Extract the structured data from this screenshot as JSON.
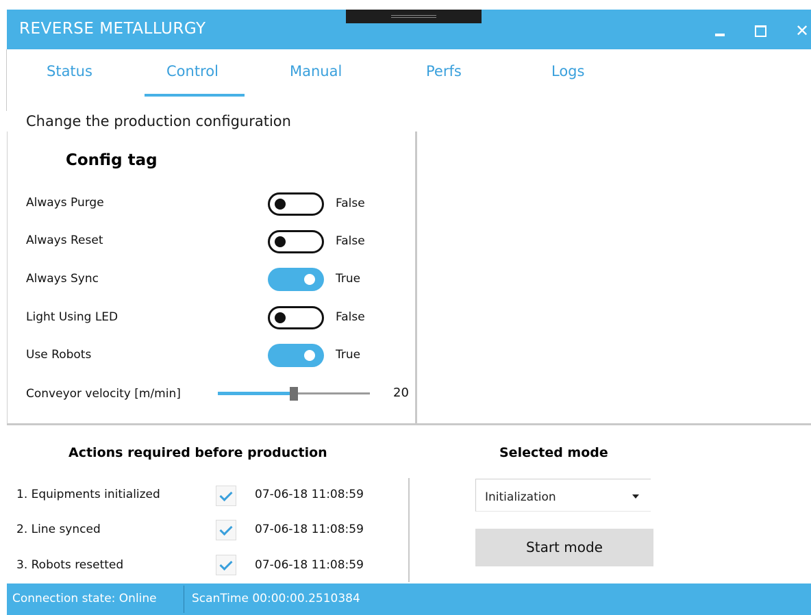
{
  "window": {
    "title": "REVERSE METALLURGY",
    "minimize_icon": "minimize-icon",
    "maximize_icon": "maximize-icon",
    "close_icon": "close-icon",
    "close_glyph": "✕"
  },
  "tabs": [
    {
      "label": "Status",
      "selected": false
    },
    {
      "label": "Control",
      "selected": true
    },
    {
      "label": "Manual",
      "selected": false
    },
    {
      "label": "Perfs",
      "selected": false
    },
    {
      "label": "Logs",
      "selected": false
    }
  ],
  "control": {
    "subtitle": "Change the production configuration",
    "config_title": "Config tag",
    "settings": [
      {
        "label": "Always Purge",
        "on": false,
        "value": "False"
      },
      {
        "label": "Always Reset",
        "on": false,
        "value": "False"
      },
      {
        "label": "Always Sync",
        "on": true,
        "value": "True"
      },
      {
        "label": "Light Using LED",
        "on": false,
        "value": "False"
      },
      {
        "label": "Use Robots",
        "on": true,
        "value": "True"
      }
    ],
    "conveyor": {
      "label": "Conveyor velocity [m/min]",
      "value": "20",
      "fraction": 0.5
    }
  },
  "actions": {
    "title": "Actions required before production",
    "items": [
      {
        "label": "1. Equipments initialized",
        "checked": true,
        "time": "07-06-18 11:08:59"
      },
      {
        "label": "2. Line synced",
        "checked": true,
        "time": "07-06-18 11:08:59"
      },
      {
        "label": "3. Robots resetted",
        "checked": true,
        "time": "07-06-18 11:08:59"
      }
    ]
  },
  "mode": {
    "title": "Selected mode",
    "selected": "Initialization",
    "start_label": "Start mode"
  },
  "statusbar": {
    "connection": "Connection state: Online",
    "scan_time": "ScanTime 00:00:00.2510384"
  },
  "colors": {
    "accent": "#47b1e6",
    "tab_text": "#3aa0dc",
    "toggle_on": "#47b1e6",
    "toggle_off_border": "#111111"
  }
}
